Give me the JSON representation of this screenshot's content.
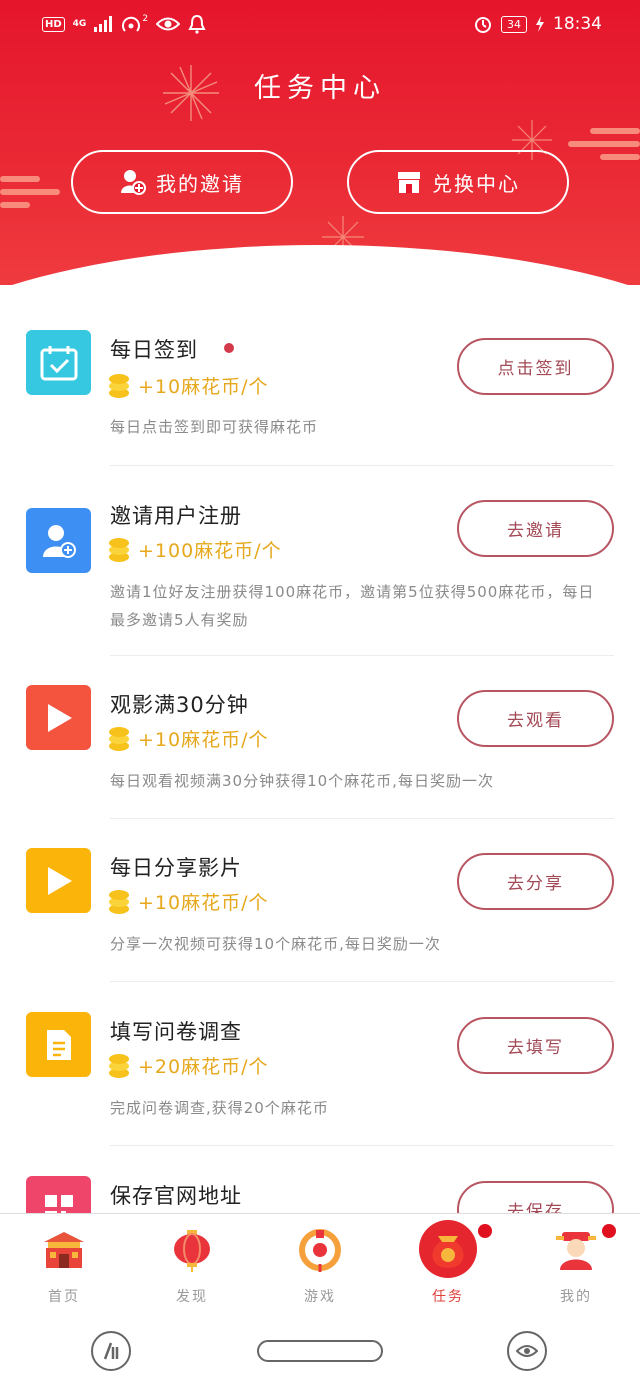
{
  "status_bar": {
    "hd": "HD",
    "network": "4G",
    "hotspot_count": "2",
    "battery": "34",
    "time": "18:34"
  },
  "header": {
    "title": "任务中心",
    "invite_label": "我的邀请",
    "exchange_label": "兑换中心"
  },
  "tasks": [
    {
      "title": "每日签到",
      "has_dot": true,
      "reward": "+10麻花币/个",
      "desc": "每日点击签到即可获得麻花币",
      "button": "点击签到",
      "icon": "calendar-check-icon",
      "color": "#35c8e0"
    },
    {
      "title": "邀请用户注册",
      "reward": "+100麻花币/个",
      "desc": "邀请1位好友注册获得100麻花币，邀请第5位获得500麻花币，每日最多邀请5人有奖励",
      "button": "去邀请",
      "icon": "add-user-icon",
      "color": "#3d8ff3"
    },
    {
      "title": "观影满30分钟",
      "reward": "+10麻花币/个",
      "desc": "每日观看视频满30分钟获得10个麻花币,每日奖励一次",
      "button": "去观看",
      "icon": "play-icon",
      "color": "#f4533e"
    },
    {
      "title": "每日分享影片",
      "reward": "+10麻花币/个",
      "desc": "分享一次视频可获得10个麻花币,每日奖励一次",
      "button": "去分享",
      "icon": "play-icon",
      "color": "#fbb40a"
    },
    {
      "title": "填写问卷调查",
      "reward": "+20麻花币/个",
      "desc": "完成问卷调查,获得20个麻花币",
      "button": "去填写",
      "icon": "document-icon",
      "color": "#fbb40a"
    },
    {
      "title": "保存官网地址",
      "button": "去保存",
      "icon": "qr-code-icon",
      "color": "#f0456a"
    }
  ],
  "nav": {
    "home": "首页",
    "discover": "发现",
    "games": "游戏",
    "tasks": "任务",
    "mine": "我的"
  },
  "colors": {
    "header_red": "#e5152c",
    "reward_gold": "#e6a81c",
    "button_border": "#b85562",
    "active_nav": "#e0403a"
  }
}
